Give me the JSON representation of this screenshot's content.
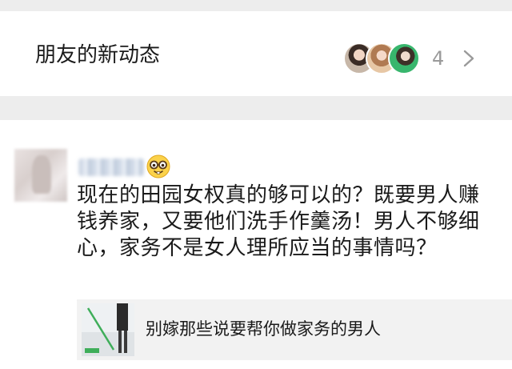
{
  "friends_feed": {
    "title": "朋友的新动态",
    "count": "4",
    "avatars": [
      "friend-avatar",
      "friend-avatar",
      "friend-avatar"
    ]
  },
  "post": {
    "text": "现在的田园女权真的够可以的？既要男人赚钱养家，又要他们洗手作羹汤！男人不够细心，家务不是女人理所应当的事情吗？",
    "emoji": "nerd-face-icon",
    "link_card": {
      "title": "别嫁那些说要帮你做家务的男人"
    }
  },
  "colors": {
    "background": "#ffffff",
    "divider": "#ededed",
    "muted_text": "#9a9a9a",
    "link_card_bg": "#f2f2f2"
  }
}
